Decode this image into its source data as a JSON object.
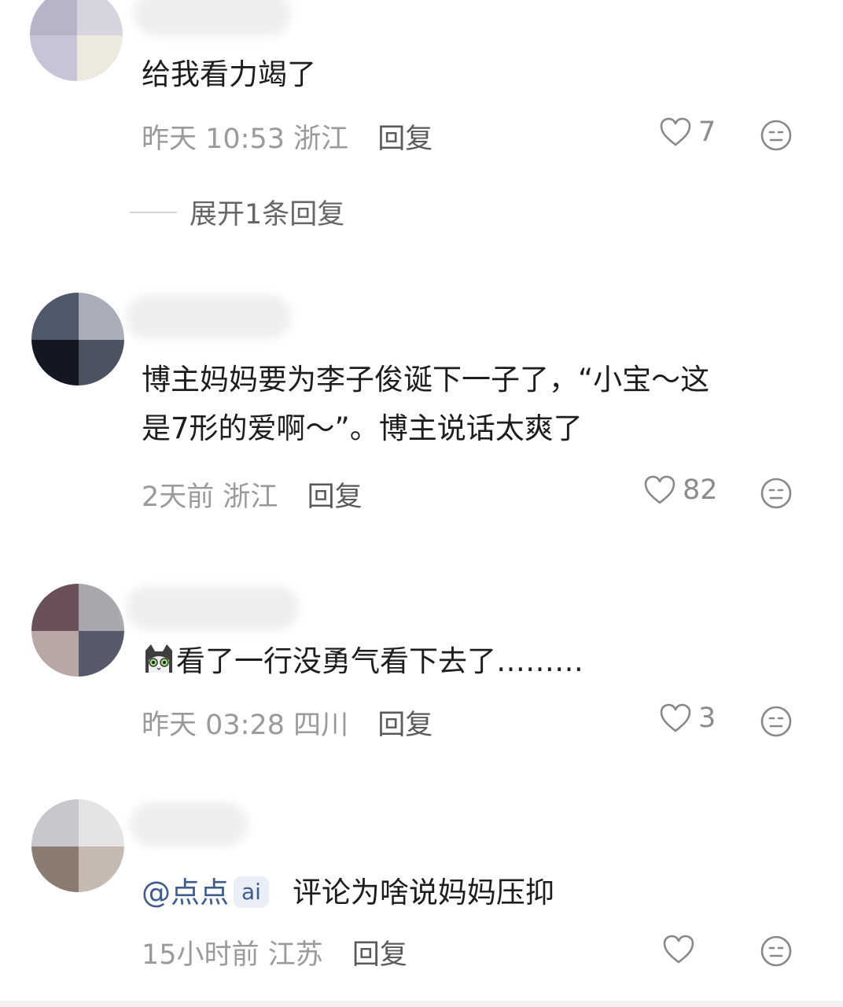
{
  "comments": [
    {
      "text": "给我看力竭了",
      "time": "昨天 10:53",
      "location": "浙江",
      "reply_label": "回复",
      "likes": "7",
      "expand_label": "展开1条回复"
    },
    {
      "text_line1": "博主妈妈要为李子俊诞下一子了，“小宝～这",
      "text_line2": "是7形的爱啊～”。博主说话太爽了",
      "time": "2天前",
      "location": "浙江",
      "reply_label": "回复",
      "likes": "82"
    },
    {
      "text": "看了一行没勇气看下去了………",
      "time": "昨天 03:28",
      "location": "四川",
      "reply_label": "回复",
      "likes": "3"
    },
    {
      "mention": "@点点",
      "ai_tag": "ai",
      "text": "评论为啥说妈妈压抑",
      "time": "15小时前",
      "location": "江苏",
      "reply_label": "回复"
    }
  ],
  "icons": {
    "like": "heart-outline-icon",
    "dislike": "meh-face-icon",
    "emoji": "cat-emoji-icon"
  },
  "colors": {
    "meta": "#9a9a9a",
    "mention": "#3f5c8f",
    "text": "#1d1d1d"
  }
}
